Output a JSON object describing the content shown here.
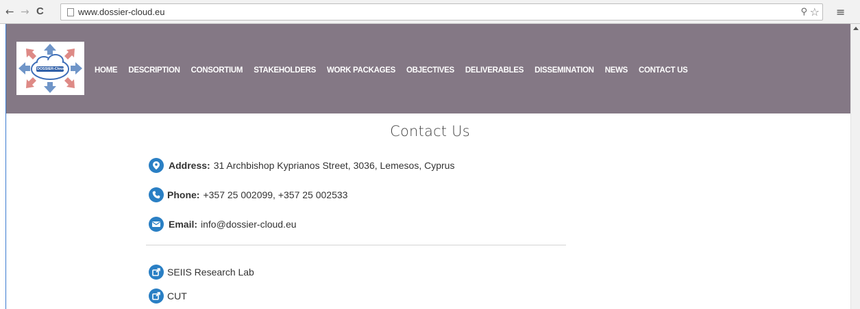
{
  "browser": {
    "url": "www.dossier-cloud.eu",
    "back_icon": "←",
    "forward_icon": "→",
    "reload_icon": "C",
    "zoom_icon": "⚲",
    "star_icon": "☆",
    "menu_icon": "≡"
  },
  "header": {
    "logo_text": "DOSSIER-Cloud",
    "nav": [
      "HOME",
      "DESCRIPTION",
      "CONSORTIUM",
      "STAKEHOLDERS",
      "WORK PACKAGES",
      "OBJECTIVES",
      "DELIVERABLES",
      "DISSEMINATION",
      "NEWS",
      "CONTACT US"
    ],
    "background_color": "#847885"
  },
  "contact": {
    "title": "Contact Us",
    "address_label": "Address:",
    "address_value": "31 Archbishop Kyprianos Street, 3036, Lemesos, Cyprus",
    "phone_label": "Phone:",
    "phone_value": "+357 25 002099, +357 25 002533",
    "email_label": "Email:",
    "email_value": "info@dossier-cloud.eu",
    "links": [
      "SEIIS Research Lab",
      "CUT"
    ],
    "icon_color": "#2a7fc4"
  }
}
